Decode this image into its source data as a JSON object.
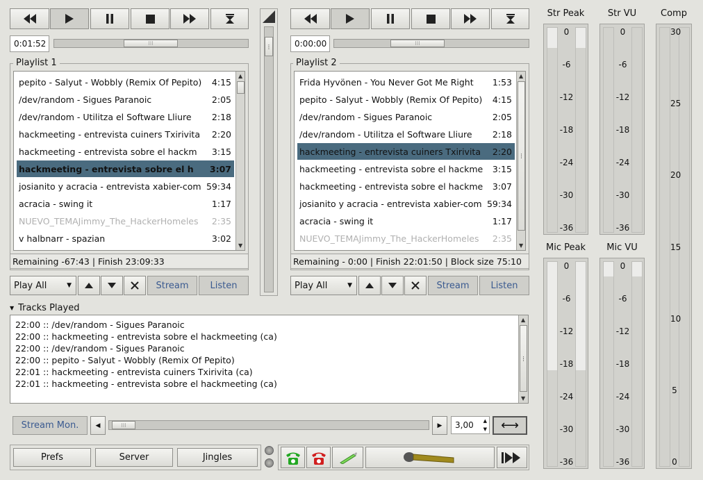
{
  "deck1": {
    "time": "0:01:52",
    "playlist_title": "Playlist 1",
    "tracks": [
      {
        "title": "pepito - Salyut - Wobbly (Remix Of Pepito)",
        "duration": "4:15"
      },
      {
        "title": "/dev/random - Sigues Paranoic",
        "duration": "2:05"
      },
      {
        "title": "/dev/random - Utilitza el Software Lliure",
        "duration": "2:18"
      },
      {
        "title": "hackmeeting - entrevista cuiners Txirivita",
        "duration": "2:20"
      },
      {
        "title": "hackmeeting - entrevista sobre el hackm",
        "duration": "3:15"
      },
      {
        "title": "hackmeeting - entrevista sobre el h",
        "duration": "3:07"
      },
      {
        "title": "josianito y acracia - entrevista xabier-com",
        "duration": "59:34"
      },
      {
        "title": "acracia - swing it",
        "duration": "1:17"
      },
      {
        "title": "NUEVO_TEMAJimmy_The_HackerHomeles",
        "duration": "2:35"
      },
      {
        "title": "v halbnarr - spazian",
        "duration": "3:02"
      }
    ],
    "status": "Remaining -67:43 | Finish 23:09:33",
    "mode": "Play All",
    "stream_label": "Stream",
    "listen_label": "Listen"
  },
  "deck2": {
    "time": "0:00:00",
    "playlist_title": "Playlist 2",
    "tracks": [
      {
        "title": "Frida Hyvönen - You Never Got Me Right",
        "duration": "1:53"
      },
      {
        "title": "pepito - Salyut - Wobbly (Remix Of Pepito)",
        "duration": "4:15"
      },
      {
        "title": "/dev/random - Sigues Paranoic",
        "duration": "2:05"
      },
      {
        "title": "/dev/random - Utilitza el Software Lliure",
        "duration": "2:18"
      },
      {
        "title": "hackmeeting - entrevista cuiners Txirivita",
        "duration": "2:20"
      },
      {
        "title": "hackmeeting - entrevista sobre el hackme",
        "duration": "3:15"
      },
      {
        "title": "hackmeeting - entrevista sobre el hackme",
        "duration": "3:07"
      },
      {
        "title": "josianito y acracia - entrevista xabier-com",
        "duration": "59:34"
      },
      {
        "title": "acracia - swing it",
        "duration": "1:17"
      },
      {
        "title": "NUEVO_TEMAJimmy_The_HackerHomeles",
        "duration": "2:35"
      }
    ],
    "status": "Remaining - 0:00 | Finish 22:01:50 | Block size 75:10",
    "mode": "Play All",
    "stream_label": "Stream",
    "listen_label": "Listen"
  },
  "tracks_played": {
    "title": "Tracks Played",
    "lines": [
      "22:00 :: /dev/random - Sigues Paranoic",
      "22:00 :: hackmeeting - entrevista sobre el hackmeeting (ca)",
      "22:00 :: /dev/random - Sigues Paranoic",
      "22:00 :: pepito - Salyut - Wobbly (Remix Of Pepito)",
      "22:01 :: hackmeeting - entrevista cuiners Txirivita (ca)",
      "22:01 :: hackmeeting - entrevista sobre el hackmeeting (ca)"
    ]
  },
  "bottom": {
    "stream_mon": "Stream Mon.",
    "spin_value": "3,00",
    "prefs": "Prefs",
    "server": "Server",
    "jingles": "Jingles"
  },
  "meters": {
    "str_peak": {
      "title": "Str Peak",
      "level_left": 0.1,
      "level_right": 0.1
    },
    "str_vu": {
      "title": "Str VU",
      "level_left": 0,
      "level_right": 0
    },
    "mic_peak": {
      "title": "Mic Peak",
      "level_left": 0.53,
      "level_right": 0.53
    },
    "mic_vu": {
      "title": "Mic VU",
      "level_left": 0.07,
      "level_right": 0.07
    },
    "comp": {
      "title": "Comp",
      "level_left": 0.0,
      "level_right": 0.0
    },
    "db_ticks": [
      "0",
      "-6",
      "-12",
      "-18",
      "-24",
      "-30",
      "-36"
    ],
    "comp_ticks": [
      "30",
      "25",
      "20",
      "15",
      "10",
      "5",
      "0"
    ]
  },
  "colors": {
    "selection": "#4a6b7f",
    "accent_tab": "#3a5a90",
    "phone_green": "#22a722",
    "phone_red": "#d11f1f"
  }
}
